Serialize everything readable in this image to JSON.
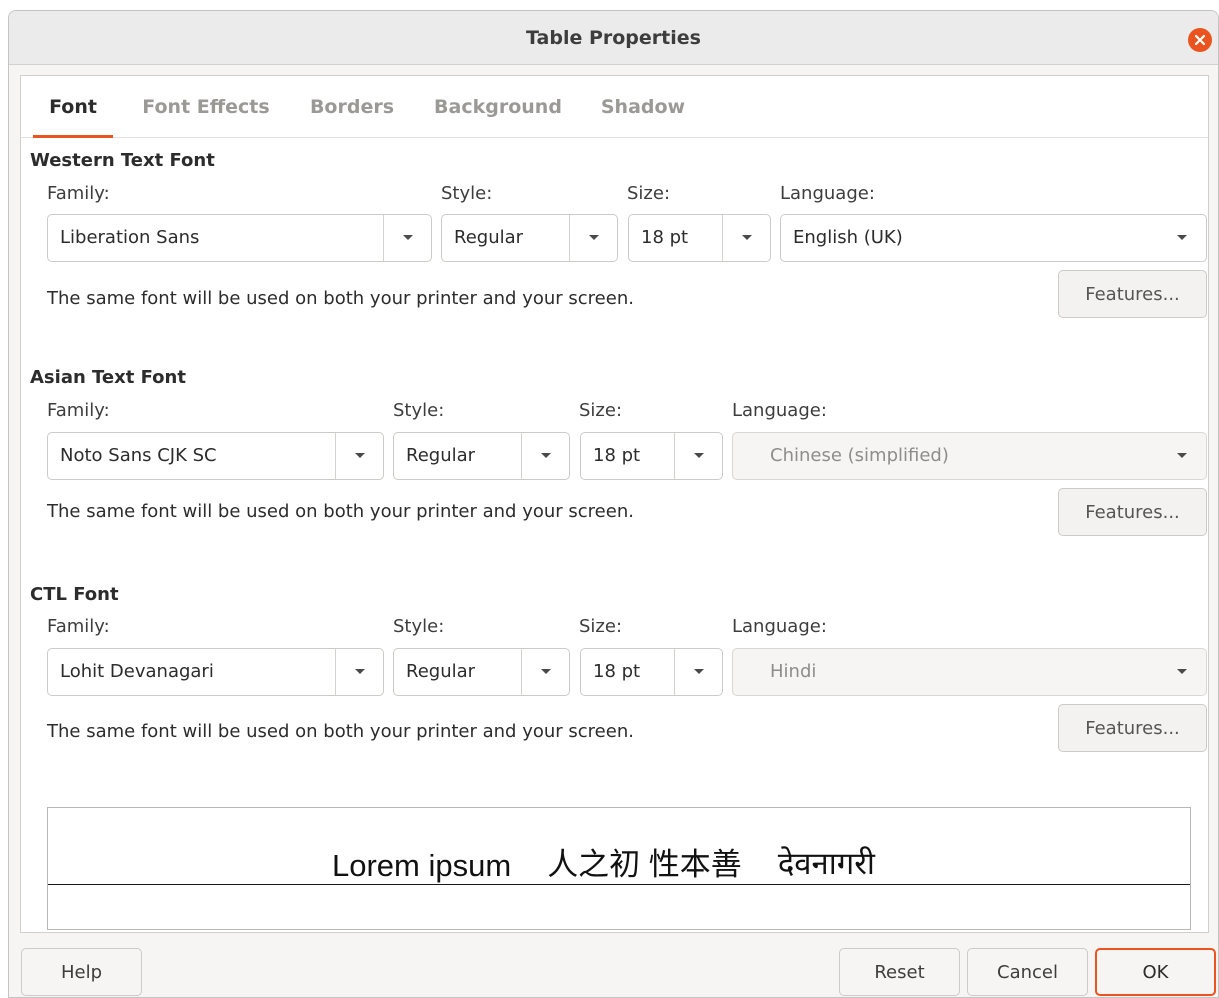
{
  "window": {
    "title": "Table Properties"
  },
  "tabs": [
    {
      "label": "Font",
      "active": true
    },
    {
      "label": "Font Effects",
      "active": false
    },
    {
      "label": "Borders",
      "active": false
    },
    {
      "label": "Background",
      "active": false
    },
    {
      "label": "Shadow",
      "active": false
    }
  ],
  "western": {
    "heading": "Western Text Font",
    "family_label": "Family:",
    "family": "Liberation Sans",
    "style_label": "Style:",
    "style": "Regular",
    "size_label": "Size:",
    "size": "18 pt",
    "language_label": "Language:",
    "language": "English (UK)",
    "info": "The same font will be used on both your printer and your screen.",
    "features": "Features..."
  },
  "asian": {
    "heading": "Asian Text Font",
    "family_label": "Family:",
    "family": "Noto Sans CJK SC",
    "style_label": "Style:",
    "style": "Regular",
    "size_label": "Size:",
    "size": "18 pt",
    "language_label": "Language:",
    "language": "Chinese (simplified)",
    "info": "The same font will be used on both your printer and your screen.",
    "features": "Features..."
  },
  "ctl": {
    "heading": "CTL Font",
    "family_label": "Family:",
    "family": "Lohit Devanagari",
    "style_label": "Style:",
    "style": "Regular",
    "size_label": "Size:",
    "size": "18 pt",
    "language_label": "Language:",
    "language": "Hindi",
    "info": "The same font will be used on both your printer and your screen.",
    "features": "Features..."
  },
  "preview": {
    "western": "Lorem ipsum",
    "asian": "人之初 性本善",
    "ctl": "देवनागरी"
  },
  "buttons": {
    "help": "Help",
    "reset": "Reset",
    "cancel": "Cancel",
    "ok": "OK"
  },
  "colors": {
    "accent": "#e95420",
    "window_bg": "#f6f5f4",
    "panel_bg": "#ffffff"
  },
  "icons": {
    "close": "close-icon",
    "dropdown": "chevron-down-icon"
  }
}
